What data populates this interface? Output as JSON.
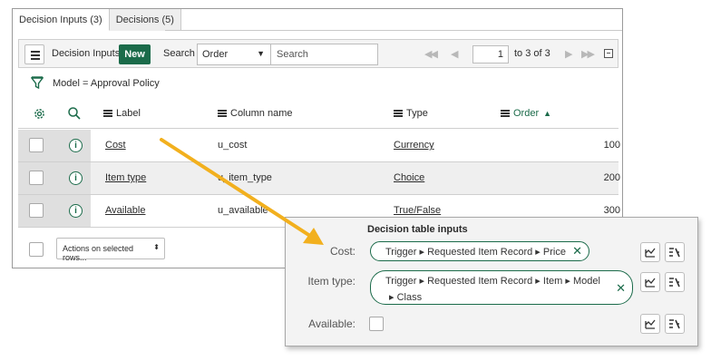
{
  "tabs": [
    {
      "label": "Decision Inputs (3)",
      "active": true
    },
    {
      "label": "Decisions (5)",
      "active": false
    }
  ],
  "toolbar": {
    "title": "Decision Inputs",
    "new_label": "New",
    "search_label": "Search",
    "search_field_value": "Order",
    "search_placeholder": "Search",
    "page_value": "1",
    "page_total": "to 3 of 3"
  },
  "filter": {
    "text": "Model = Approval Policy"
  },
  "columns": {
    "label": "Label",
    "column_name": "Column name",
    "type": "Type",
    "order": "Order"
  },
  "rows": [
    {
      "label": "Cost",
      "column_name": "u_cost",
      "type": "Currency",
      "order": "100"
    },
    {
      "label": "Item type",
      "column_name": "u_item_type",
      "type": "Choice",
      "order": "200"
    },
    {
      "label": "Available",
      "column_name": "u_available",
      "type": "True/False",
      "order": "300"
    }
  ],
  "footer": {
    "actions_label": "Actions on selected rows..."
  },
  "overlay": {
    "title": "Decision table inputs",
    "inputs": [
      {
        "label": "Cost:",
        "path": [
          "Trigger",
          "Requested Item Record",
          "Price"
        ]
      },
      {
        "label": "Item type:",
        "path_line1": [
          "Trigger",
          "Requested Item Record",
          "Item",
          "Model"
        ],
        "path_line2": [
          "Class"
        ]
      },
      {
        "label": "Available:"
      }
    ]
  },
  "colors": {
    "accent": "#1b6b4a",
    "arrow": "#f2b01e"
  }
}
